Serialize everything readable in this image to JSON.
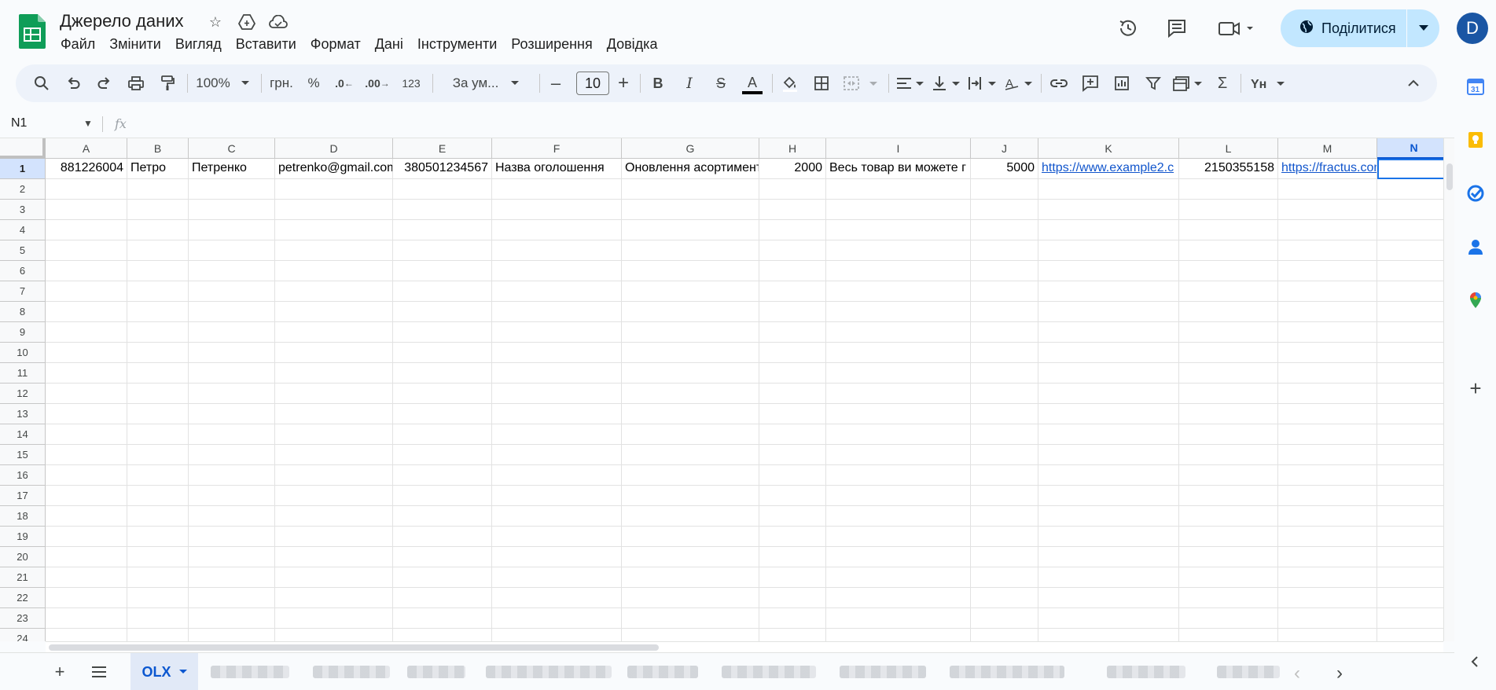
{
  "app": {
    "title": "Джерело даних",
    "menu": [
      "Файл",
      "Змінити",
      "Вигляд",
      "Вставити",
      "Формат",
      "Дані",
      "Інструменти",
      "Розширення",
      "Довідка"
    ],
    "share_label": "Поділитися",
    "avatar_letter": "D"
  },
  "toolbar": {
    "zoom": "100%",
    "currency": "грн.",
    "percent": "%",
    "decrease_decimals": ".0",
    "increase_decimals": ".00",
    "number_format": "123",
    "font": "За ум...",
    "font_size": "10",
    "bold": "B",
    "italic": "I",
    "strike": "S",
    "text_color": "A"
  },
  "formula_bar": {
    "cell_ref": "N1",
    "fx": "fx"
  },
  "grid": {
    "columns": [
      "A",
      "B",
      "C",
      "D",
      "E",
      "F",
      "G",
      "H",
      "I",
      "J",
      "K",
      "L",
      "M",
      "N"
    ],
    "selected_column": "N",
    "rows": [
      "1",
      "2",
      "3",
      "4",
      "5",
      "6",
      "7",
      "8",
      "9",
      "10",
      "11",
      "12",
      "13",
      "14",
      "15",
      "16",
      "17",
      "18",
      "19",
      "20",
      "21",
      "22",
      "23",
      "24"
    ],
    "row1": [
      "881226004",
      "Петро",
      "Петренко",
      "petrenko@gmail.com",
      "380501234567",
      "Назва оголошення",
      "Оновлення асортименту",
      "2000",
      "Весь товар ви можете г",
      "5000",
      "https://www.example2.c",
      "2150355158",
      "https://fractus.com.ua/wp-co",
      ""
    ]
  },
  "sheets": {
    "active_tab": "OLX"
  },
  "colors": {
    "accent": "#0b57d0",
    "share_bg": "#c2e7ff",
    "link": "#1155cc",
    "sheets_green": "#0f9d58"
  }
}
